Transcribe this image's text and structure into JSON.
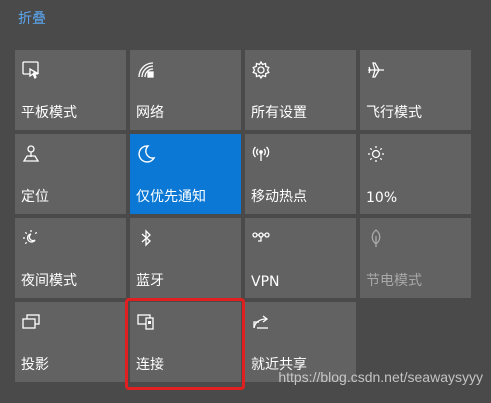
{
  "header": {
    "collapse_label": "折叠"
  },
  "tiles": [
    {
      "label": "平板模式",
      "icon": "tablet-mode-icon"
    },
    {
      "label": "网络",
      "icon": "network-icon"
    },
    {
      "label": "所有设置",
      "icon": "settings-gear-icon"
    },
    {
      "label": "飞行模式",
      "icon": "airplane-icon"
    },
    {
      "label": "定位",
      "icon": "location-icon"
    },
    {
      "label": "仅优先通知",
      "icon": "moon-icon",
      "state": "on"
    },
    {
      "label": "移动热点",
      "icon": "hotspot-icon"
    },
    {
      "label": "10%",
      "icon": "brightness-icon"
    },
    {
      "label": "夜间模式",
      "icon": "night-light-icon"
    },
    {
      "label": "蓝牙",
      "icon": "bluetooth-icon"
    },
    {
      "label": "VPN",
      "icon": "vpn-icon"
    },
    {
      "label": "节电模式",
      "icon": "battery-saver-icon",
      "state": "disabled"
    },
    {
      "label": "投影",
      "icon": "project-icon"
    },
    {
      "label": "连接",
      "icon": "connect-icon"
    },
    {
      "label": "就近共享",
      "icon": "nearby-share-icon"
    }
  ],
  "colors": {
    "accent": "#0a78d4",
    "tile": "#626262",
    "background": "#4a4a4a",
    "highlight": "#e02020",
    "link": "#5aa7f0"
  },
  "watermark": "https://blog.csdn.net/seawaysyyy"
}
